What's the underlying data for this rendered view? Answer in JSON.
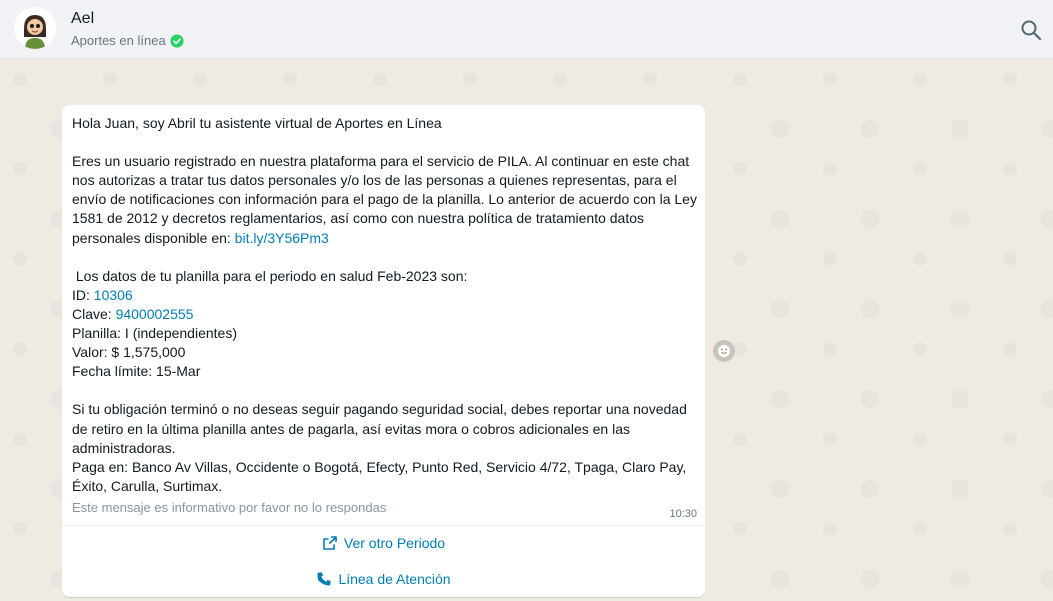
{
  "header": {
    "contact_name": "Ael",
    "contact_subtitle": "Aportes en línea"
  },
  "message": {
    "greeting": "Hola Juan, soy Abril tu asistente virtual de Aportes en Línea",
    "consent_text": "Eres un usuario registrado en nuestra plataforma para el servicio de PILA. Al continuar en este chat nos autorizas a tratar tus datos personales y/o los de las personas a quienes representas, para el envío de notificaciones con información para el pago de la planilla. Lo anterior de acuerdo con la Ley 1581 de 2012 y decretos reglamentarios, así como con nuestra política de tratamiento datos personales disponible en: ",
    "policy_link": "bit.ly/3Y56Pm3",
    "period_intro": " Los datos de tu planilla para el periodo en salud Feb-2023 son:",
    "id_label": "ID: ",
    "id_value": "10306",
    "clave_label": "Clave: ",
    "clave_value": "9400002555",
    "planilla": "Planilla: I (independientes)",
    "valor": "Valor: $ 1,575,000",
    "fecha": "Fecha límite: 15-Mar",
    "retiro_text": "Si tu obligación terminó o no deseas seguir pagando seguridad social, debes reportar una novedad de retiro en la última planilla antes de pagarla, así evitas mora o cobros adicionales en las administradoras.",
    "paga_en": "Paga en: Banco Av Villas, Occidente o Bogotá, Efecty, Punto Red, Servicio 4/72, Tpaga, Claro Pay, Éxito, Carulla, Surtimax.",
    "footer_note": "Este mensaje es informativo por favor no lo respondas",
    "time": "10:30"
  },
  "actions": {
    "ver_periodo": "Ver otro Periodo",
    "linea_atencion": "Línea de Atención"
  },
  "colors": {
    "link": "#027eb5",
    "verified": "#25d366",
    "chat_bg": "#efeae2"
  }
}
